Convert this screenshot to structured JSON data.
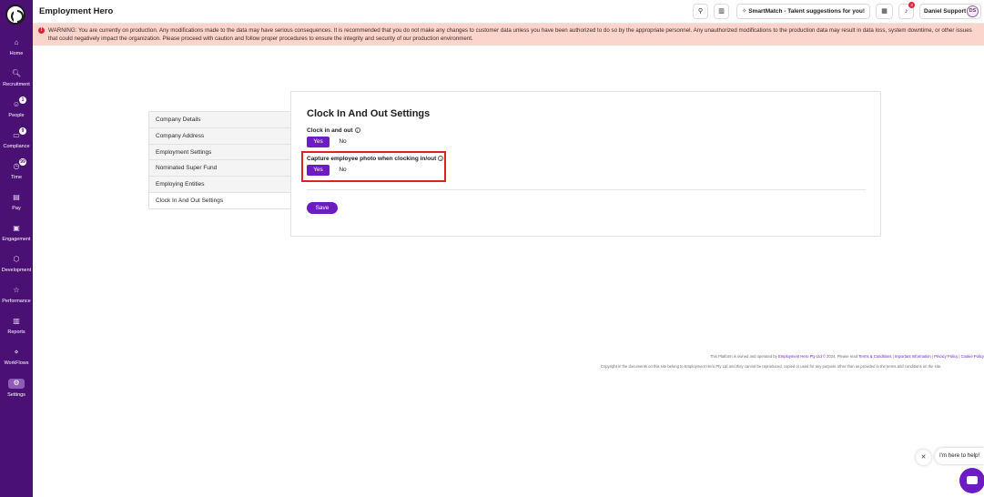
{
  "header": {
    "app_title": "Employment Hero",
    "smartmatch_label": "SmartMatch - Talent suggestions for you!",
    "notifications_count": "3",
    "user_name": "Daniel Support",
    "user_initials": "DS"
  },
  "sidebar": {
    "items": [
      {
        "label": "Home",
        "icon": "home-icon",
        "glyph": "⌂"
      },
      {
        "label": "Recruitment",
        "icon": "recruitment-icon",
        "glyph": "🔍︎"
      },
      {
        "label": "People",
        "icon": "people-icon",
        "glyph": "☺",
        "badge": "1"
      },
      {
        "label": "Compliance",
        "icon": "compliance-icon",
        "glyph": "▭",
        "badge": "9"
      },
      {
        "label": "Time",
        "icon": "time-icon",
        "glyph": "◷",
        "badge": "99"
      },
      {
        "label": "Pay",
        "icon": "pay-icon",
        "glyph": "▤"
      },
      {
        "label": "Engagement",
        "icon": "engagement-icon",
        "glyph": "▣"
      },
      {
        "label": "Development",
        "icon": "development-icon",
        "glyph": "⬡"
      },
      {
        "label": "Performance",
        "icon": "performance-icon",
        "glyph": "☆"
      },
      {
        "label": "Reports",
        "icon": "reports-icon",
        "glyph": "▥"
      },
      {
        "label": "WorkFlows",
        "icon": "workflows-icon",
        "glyph": "⋄"
      },
      {
        "label": "Settings",
        "icon": "gear-icon",
        "glyph": "⚙",
        "active": true
      }
    ]
  },
  "warning": {
    "text": "WARNING: You are currently on production. Any modifications made to the data may have serious consequences. It is recommended that you do not make any changes to customer data unless you have been authorized to do so by the appropriate personnel. Any unauthorized modifications to the production data may result in data loss, system downtime, or other issues that could negatively impact the organization. Please proceed with caution and follow proper procedures to ensure the integrity and security of our production environment."
  },
  "settings_nav": {
    "items": [
      {
        "label": "Company Details"
      },
      {
        "label": "Company Address"
      },
      {
        "label": "Employment Settings"
      },
      {
        "label": "Nominated Super Fund"
      },
      {
        "label": "Employing Entities"
      },
      {
        "label": "Clock In And Out Settings",
        "active": true
      }
    ]
  },
  "content": {
    "title": "Clock In And Out Settings",
    "clock_in_out": {
      "label": "Clock in and out",
      "yes": "Yes",
      "no": "No",
      "selected": "Yes"
    },
    "capture_photo": {
      "label": "Capture employee photo when clocking in/out",
      "yes": "Yes",
      "no": "No",
      "selected": "Yes"
    },
    "save_label": "Save"
  },
  "footer": {
    "line1_prefix": "This Platform is owned and operated by ",
    "line1_company": "Employment Hero Pty Ltd",
    "line1_mid": " © 2024. Please read ",
    "links": [
      "Terms & Conditions",
      "Important Information",
      "Privacy Policy",
      "Cookie Policy"
    ],
    "line2": "Copyright in the documents on this site belong to Employment Hero Pty Ltd and they cannot be reproduced, copied or used for any purpose other than as provided in the terms and conditions on the site."
  },
  "help": {
    "bubble_text": "I'm here to help!"
  },
  "colors": {
    "sidebar_bg": "#4a1073",
    "primary": "#6d1cc4",
    "warning_bg": "#fbd5cc",
    "highlight_border": "#e0241b"
  }
}
